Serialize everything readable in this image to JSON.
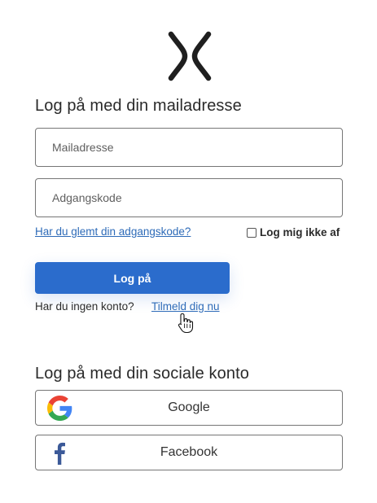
{
  "brand": {
    "logo_icon": "x-logo-icon",
    "logo_color": "#1f1f1f"
  },
  "email_login": {
    "heading": "Log på med din mailadresse",
    "email_placeholder": "Mailadresse",
    "password_placeholder": "Adgangskode",
    "forgot_password_label": "Har du glemt din adgangskode?",
    "remember_label": "Log mig ikke af",
    "remember_checked": false,
    "login_button_label": "Log på",
    "no_account_text": "Har du ingen konto?",
    "signup_link_label": "Tilmeld dig nu"
  },
  "social_login": {
    "heading": "Log på med din sociale konto",
    "buttons": [
      {
        "label": "Google",
        "icon": "google-icon"
      },
      {
        "label": "Facebook",
        "icon": "facebook-icon"
      }
    ]
  },
  "colors": {
    "primary": "#2b6ccc",
    "link": "#2e6bb8",
    "text": "#2b2b2b",
    "border": "#767676",
    "facebook": "#3b5998"
  }
}
